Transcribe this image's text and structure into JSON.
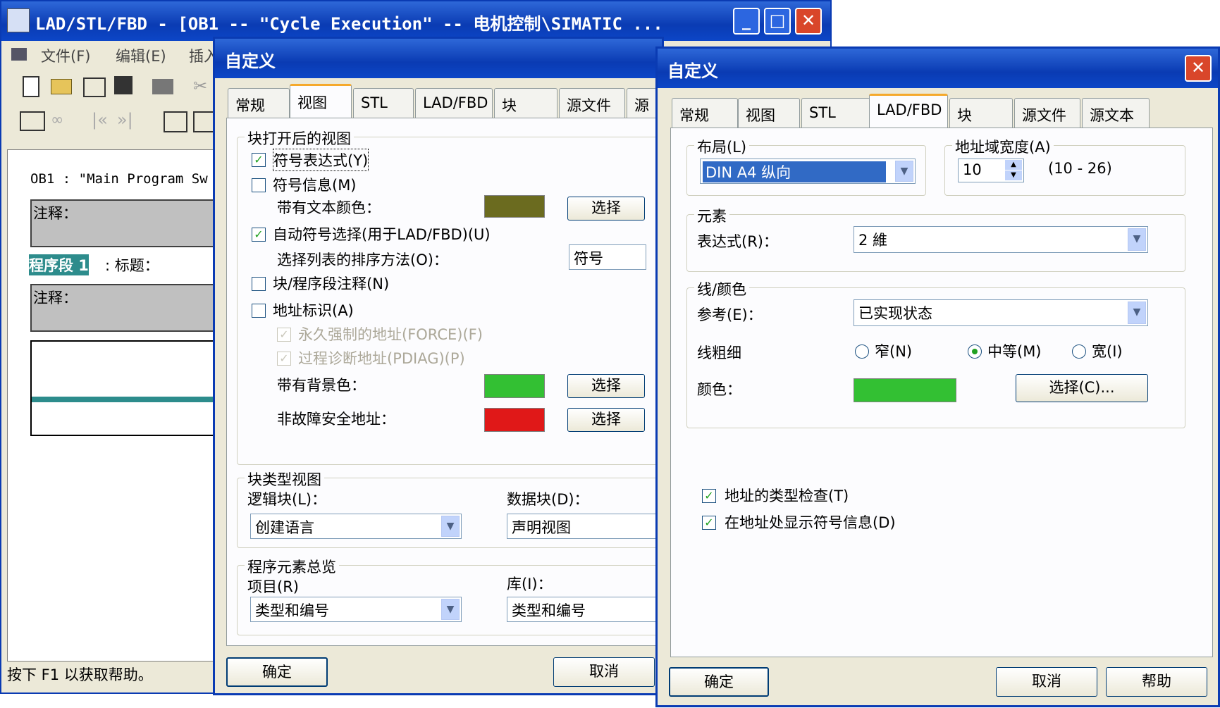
{
  "main": {
    "title": "LAD/STL/FBD  - [OB1 -- \"Cycle Execution\" -- 电机控制\\SIMATIC ...",
    "menus": [
      "文件(F)",
      "编辑(E)",
      "插入"
    ],
    "block_header": "OB1 :   \"Main Program Sw",
    "comment_label": "注释：",
    "network_label": "程序段 1",
    "network_title": ": 标题：",
    "comment_label2": "注释：",
    "status": "按下 F1 以获取帮助。"
  },
  "dialog1": {
    "title": "自定义",
    "tabs": [
      "常规",
      "视图",
      "STL",
      "LAD/FBD",
      "块",
      "源文件",
      "源"
    ],
    "group_open_view": "块打开后的视图",
    "opt_symbolic": "符号表达式(Y)",
    "opt_symbol_info": "符号信息(M)",
    "with_text_color": "带有文本颜色：",
    "select": "选择",
    "opt_auto_symbol": "自动符号选择(用于LAD/FBD)(U)",
    "sort_method": "选择列表的排序方法(O)：",
    "sort_value": "符号",
    "opt_block_comment": "块/程序段注释(N)",
    "opt_address_id": "地址标识(A)",
    "opt_force": "永久强制的地址(FORCE)(F)",
    "opt_pdiag": "过程诊断地址(PDIAG)(P)",
    "bg_color": "带有背景色：",
    "non_failsafe": "非故障安全地址：",
    "group_block_type": "块类型视图",
    "logic_block": "逻辑块(L)：",
    "logic_value": "创建语言",
    "data_block": "数据块(D)：",
    "data_value": "声明视图",
    "group_overview": "程序元素总览",
    "item": "项目(R)",
    "item_value": "类型和编号",
    "library": "库(I)：",
    "library_value": "类型和编号",
    "ok": "确定",
    "cancel": "取消",
    "colors": {
      "text": "#6b6b1f",
      "bg": "#33c033",
      "failsafe": "#e01818"
    }
  },
  "dialog2": {
    "title": "自定义",
    "tabs": [
      "常规",
      "视图",
      "STL",
      "LAD/FBD",
      "块",
      "源文件",
      "源文本"
    ],
    "layout_group": "布局(L)",
    "layout_value": "DIN A4 纵向",
    "width_group": "地址域宽度(A)",
    "width_value": "10",
    "width_range": "(10 - 26)",
    "element_group": "元素",
    "expression": "表达式(R)：",
    "expression_value": "2 維",
    "line_group": "线/颜色",
    "reference": "参考(E)：",
    "reference_value": "已实现状态",
    "line_width": "线粗细",
    "narrow": "窄(N)",
    "medium": "中等(M)",
    "wide": "宽(I)",
    "color": "颜色：",
    "select_btn": "选择(C)...",
    "type_check": "地址的类型检查(T)",
    "show_symbol": "在地址处显示符号信息(D)",
    "ok": "确定",
    "cancel": "取消",
    "help": "帮助",
    "line_color": "#33c033"
  }
}
